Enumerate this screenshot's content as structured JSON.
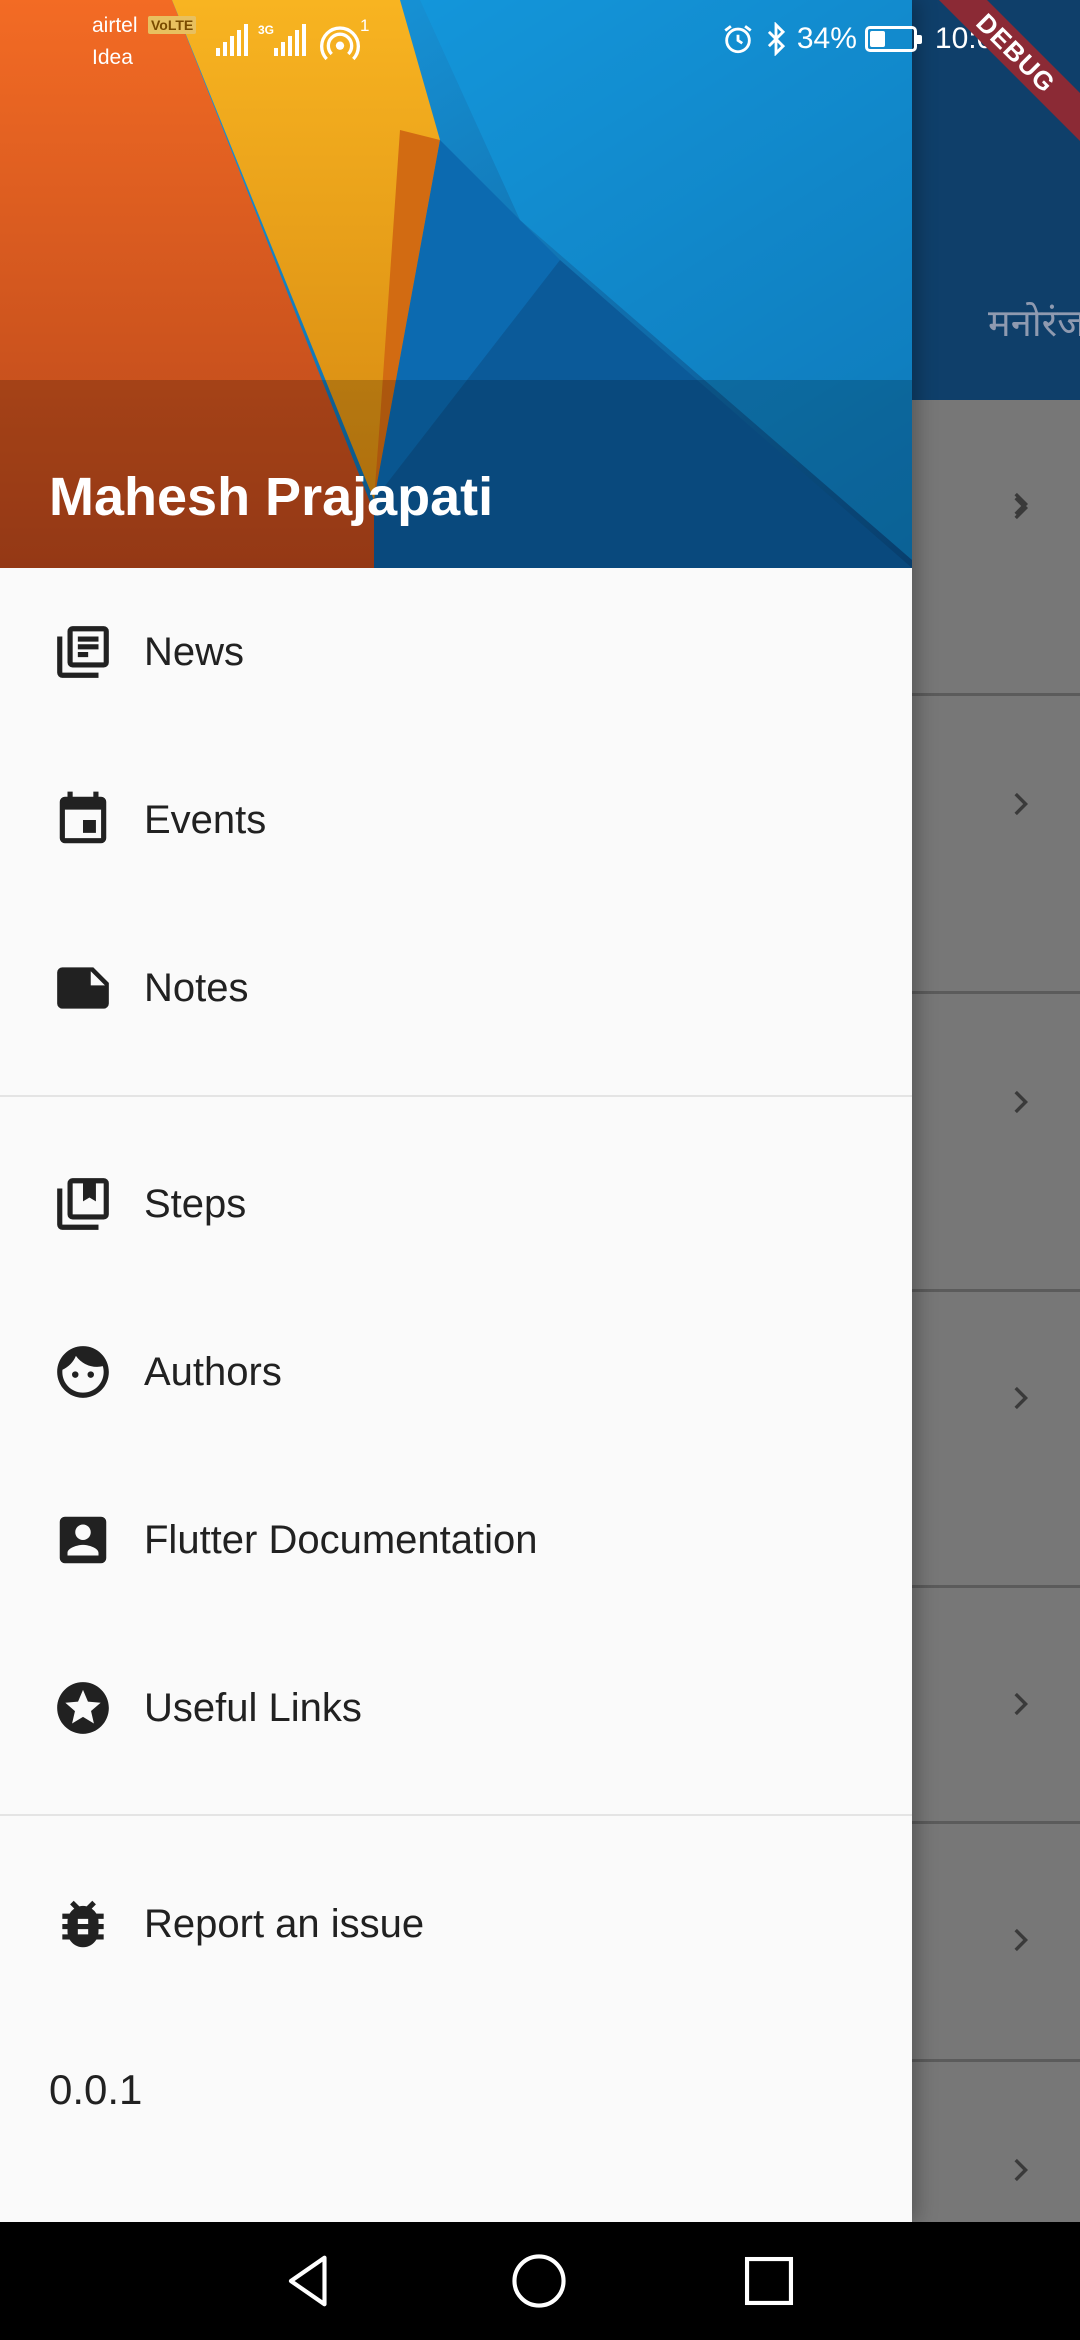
{
  "status_bar": {
    "carrier_primary": "airtel",
    "volte_badge": "VoLTE",
    "carrier_secondary": "Idea",
    "network_type": "3G",
    "hotspot_count": "1",
    "battery_percent": "34%",
    "battery_level": 0.34,
    "time": "10:08"
  },
  "debug_banner": "DEBUG",
  "background_app": {
    "title_fragment": "मनोरंज"
  },
  "drawer": {
    "header": {
      "user_name": "Mahesh Prajapati",
      "colors": [
        "#f26a25",
        "#f7a81b",
        "#1596d9",
        "#0b4f8c"
      ]
    },
    "section_1": [
      {
        "label": "News",
        "icon": "newspaper-icon"
      },
      {
        "label": "Events",
        "icon": "event-icon"
      },
      {
        "label": "Notes",
        "icon": "note-icon"
      }
    ],
    "section_2": [
      {
        "label": "Steps",
        "icon": "library-books-icon"
      },
      {
        "label": "Authors",
        "icon": "face-icon"
      },
      {
        "label": "Flutter Documentation",
        "icon": "account-box-icon"
      },
      {
        "label": "Useful Links",
        "icon": "stars-icon"
      }
    ],
    "section_3": [
      {
        "label": "Report an issue",
        "icon": "bug-report-icon"
      }
    ],
    "version": "0.0.1"
  },
  "nav_bar": {
    "buttons": [
      "back-icon",
      "home-icon",
      "recents-icon"
    ]
  }
}
